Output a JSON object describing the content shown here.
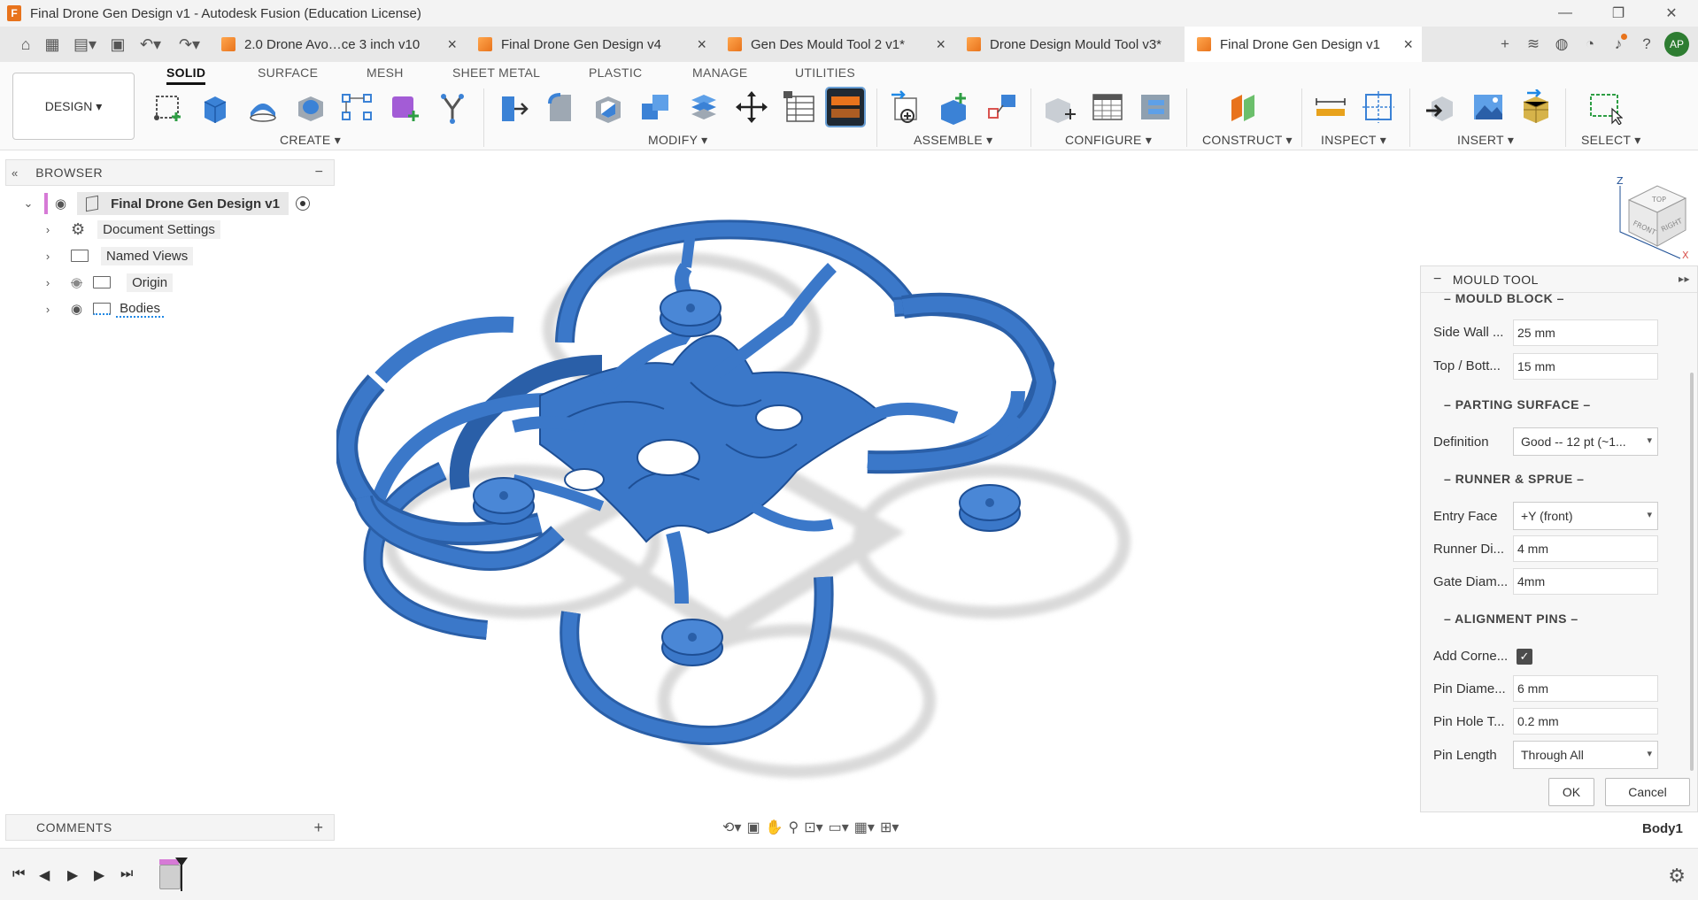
{
  "window": {
    "title": "Final Drone Gen Design v1 - Autodesk Fusion (Education License)",
    "app_icon_letter": "F",
    "minimize": "—",
    "maximize": "❐",
    "close": "✕"
  },
  "tabs": [
    {
      "label": "2.0 Drone Avo…ce 3 inch v10",
      "active": false
    },
    {
      "label": "Final Drone Gen Design v4",
      "active": false
    },
    {
      "label": "Gen Des Mould Tool 2 v1*",
      "active": false
    },
    {
      "label": "Drone Design Mould Tool v3*",
      "active": false
    },
    {
      "label": "Final Drone Gen Design v1",
      "active": true
    }
  ],
  "user": {
    "initials": "AP"
  },
  "workspace": {
    "label": "DESIGN ▾"
  },
  "ribbon": {
    "tabs": [
      "SOLID",
      "SURFACE",
      "MESH",
      "SHEET METAL",
      "PLASTIC",
      "MANAGE",
      "UTILITIES"
    ],
    "active_tab": "SOLID",
    "groups": [
      "CREATE ▾",
      "MODIFY ▾",
      "ASSEMBLE ▾",
      "CONFIGURE ▾",
      "CONSTRUCT ▾",
      "INSPECT ▾",
      "INSERT ▾",
      "SELECT ▾"
    ]
  },
  "browser": {
    "title": "BROWSER",
    "collapse": "−",
    "root": "Final Drone Gen Design v1",
    "items": [
      "Document Settings",
      "Named Views",
      "Origin",
      "Bodies"
    ]
  },
  "mould_tool": {
    "title": "MOULD TOOL",
    "sections": {
      "mould_block": "MOULD BLOCK",
      "parting_surface": "PARTING SURFACE",
      "runner_sprue": "RUNNER & SPRUE",
      "alignment_pins": "ALIGNMENT PINS"
    },
    "fields": {
      "side_wall_label": "Side Wall ...",
      "side_wall_value": "25 mm",
      "top_bottom_label": "Top / Bott...",
      "top_bottom_value": "15 mm",
      "definition_label": "Definition",
      "definition_value": "Good   -- 12 pt  (~1...",
      "entry_face_label": "Entry Face",
      "entry_face_value": "+Y  (front)",
      "runner_dia_label": "Runner Di...",
      "runner_dia_value": "4 mm",
      "gate_diam_label": "Gate Diam...",
      "gate_diam_value": "4mm",
      "add_corner_label": "Add Corne...",
      "add_corner_checked": true,
      "pin_diam_label": "Pin Diame...",
      "pin_diam_value": "6 mm",
      "pin_hole_label": "Pin Hole T...",
      "pin_hole_value": "0.2 mm",
      "pin_length_label": "Pin Length",
      "pin_length_value": "Through All"
    },
    "ok": "OK",
    "cancel": "Cancel"
  },
  "comments": {
    "title": "COMMENTS",
    "add": "+"
  },
  "status": {
    "selection": "Body1"
  },
  "viewcube": {
    "top": "TOP",
    "front": "FRONT",
    "right": "RIGHT",
    "z": "Z",
    "x": "X"
  },
  "colors": {
    "model": "#3b78c9",
    "model_dark": "#2a5fa8",
    "accent": "#e8731c"
  }
}
